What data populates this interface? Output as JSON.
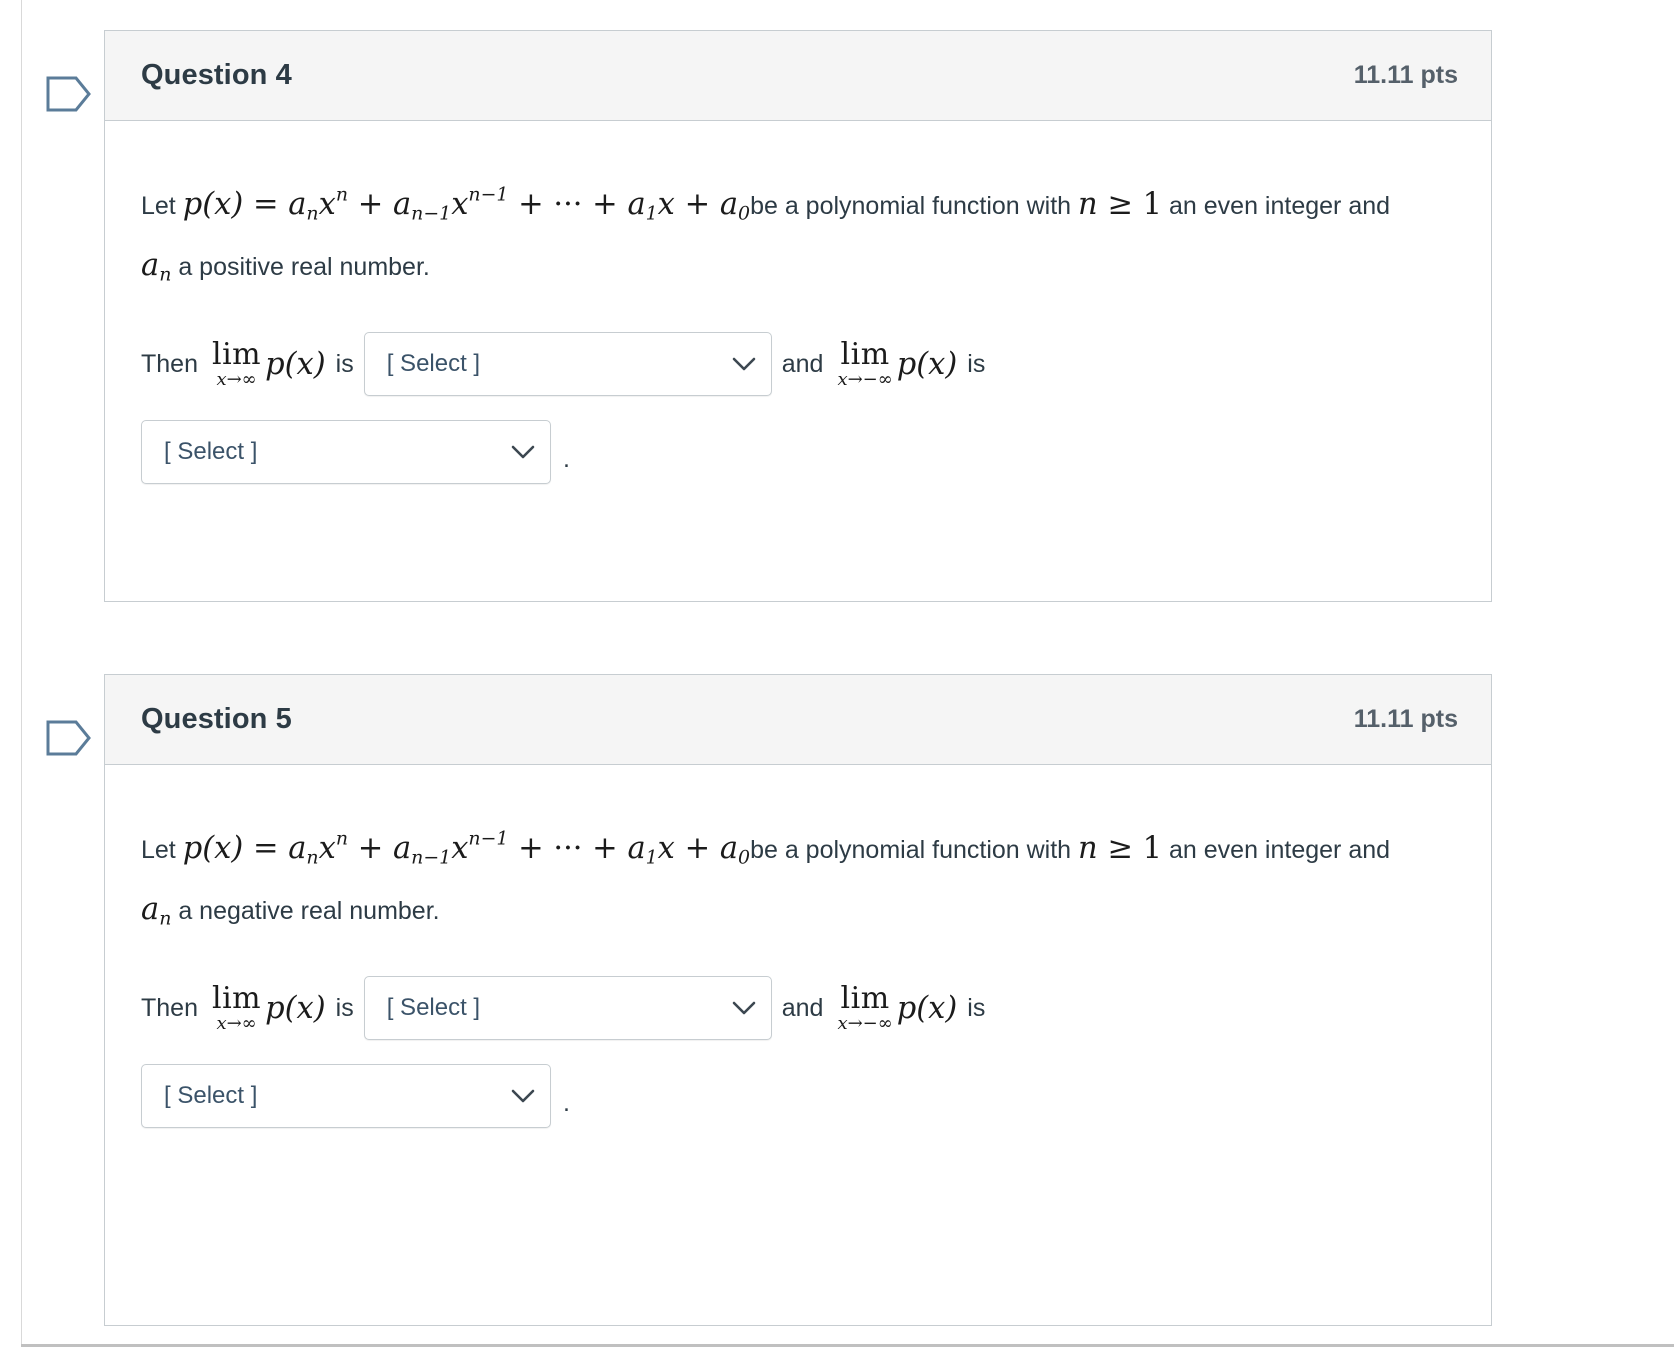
{
  "page": {
    "background_color": "#ffffff",
    "text_color": "#2d3b45",
    "card_border_color": "#c7cdd1",
    "header_background": "#f5f5f5",
    "flag_icon_color": "#5b7c99"
  },
  "questions": [
    {
      "flag_icon": "flag-outline-icon",
      "title": "Question 4",
      "points": "11.11 pts",
      "statement": {
        "prefix": "Let",
        "formula": "p(x) = aₙxⁿ + aₙ₋₁xⁿ⁻¹ + ⋯ + a₁x + a₀",
        "middle": "be a polynomial function with",
        "condition": "n ≥ 1",
        "suffix": "an even integer and",
        "coefficient": "aₙ",
        "tail": "a positive real number."
      },
      "answer": {
        "then_label": "Then",
        "limit_1": {
          "operator": "lim",
          "subscript": "x→∞",
          "function": "p(x)"
        },
        "is_label_1": "is",
        "select_1": "[ Select ]",
        "and_label": "and",
        "limit_2": {
          "operator": "lim",
          "subscript": "x→−∞",
          "function": "p(x)"
        },
        "is_label_2": "is",
        "select_2": "[ Select ]",
        "period": "."
      }
    },
    {
      "flag_icon": "flag-outline-icon",
      "title": "Question 5",
      "points": "11.11 pts",
      "statement": {
        "prefix": "Let",
        "formula": "p(x) = aₙxⁿ + aₙ₋₁xⁿ⁻¹ + ⋯ + a₁x + a₀",
        "middle": "be a polynomial function with",
        "condition": "n ≥ 1",
        "suffix": "an even integer and",
        "coefficient": "aₙ",
        "tail": "a negative real number."
      },
      "answer": {
        "then_label": "Then",
        "limit_1": {
          "operator": "lim",
          "subscript": "x→∞",
          "function": "p(x)"
        },
        "is_label_1": "is",
        "select_1": "[ Select ]",
        "and_label": "and",
        "limit_2": {
          "operator": "lim",
          "subscript": "x→−∞",
          "function": "p(x)"
        },
        "is_label_2": "is",
        "select_2": "[ Select ]",
        "period": "."
      }
    }
  ]
}
